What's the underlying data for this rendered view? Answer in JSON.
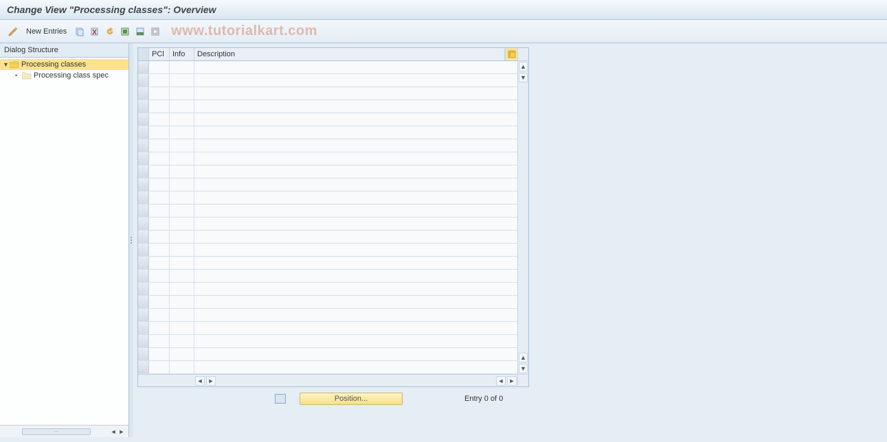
{
  "title": "Change View \"Processing classes\": Overview",
  "toolbar": {
    "new_entries": "New Entries"
  },
  "watermark": "www.tutorialkart.com",
  "sidebar": {
    "title": "Dialog Structure",
    "items": [
      {
        "label": "Processing classes",
        "selected": true,
        "level": 0,
        "expanded": true,
        "folder_open": true
      },
      {
        "label": "Processing class spec",
        "selected": false,
        "level": 1,
        "expanded": false,
        "folder_open": false
      }
    ]
  },
  "grid": {
    "columns": {
      "pcl": "PCl",
      "info": "Info",
      "description": "Description"
    },
    "row_count": 24
  },
  "footer": {
    "position_button": "Position...",
    "entry_text": "Entry 0 of 0"
  }
}
